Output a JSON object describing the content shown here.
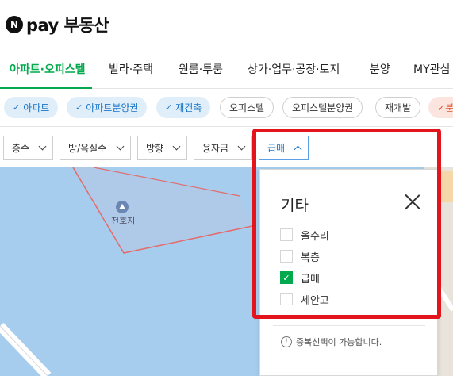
{
  "header": {
    "logo_letter": "N",
    "brand": "pay 부동산"
  },
  "tabs": [
    {
      "label": "아파트·오피스텔",
      "active": true
    },
    {
      "label": "빌라·주택"
    },
    {
      "label": "원룸·투룸"
    },
    {
      "label": "상가·업무·공장·토지"
    },
    {
      "label": "분양"
    },
    {
      "label": "MY관심"
    }
  ],
  "chips": [
    {
      "label": "아파트",
      "selected": true
    },
    {
      "label": "아파트분양권",
      "selected": true
    },
    {
      "label": "재건축",
      "selected": true
    },
    {
      "label": "오피스텔",
      "selected": false
    },
    {
      "label": "오피스텔분양권",
      "selected": false
    },
    {
      "label": "재개발",
      "selected": false
    },
    {
      "label": "분",
      "selected": true
    }
  ],
  "chip_check": "✓",
  "filters": [
    {
      "label": "층수"
    },
    {
      "label": "방/욕실수"
    },
    {
      "label": "방향"
    },
    {
      "label": "융자금"
    },
    {
      "label": "급매",
      "active": true
    }
  ],
  "map": {
    "poi_label": "천호지",
    "poi_icon": "lake-icon"
  },
  "panel": {
    "title": "기타",
    "options": [
      {
        "label": "올수리",
        "checked": false
      },
      {
        "label": "복층",
        "checked": false
      },
      {
        "label": "급매",
        "checked": true
      },
      {
        "label": "세안고",
        "checked": false
      }
    ],
    "check_glyph": "✓",
    "note": "중복선택이 가능합니다.",
    "info_glyph": "!"
  },
  "colors": {
    "accent": "#03a94d",
    "selected_chip": "#1a75c8",
    "annotation": "#e3141b",
    "water": "#a6cdee"
  }
}
